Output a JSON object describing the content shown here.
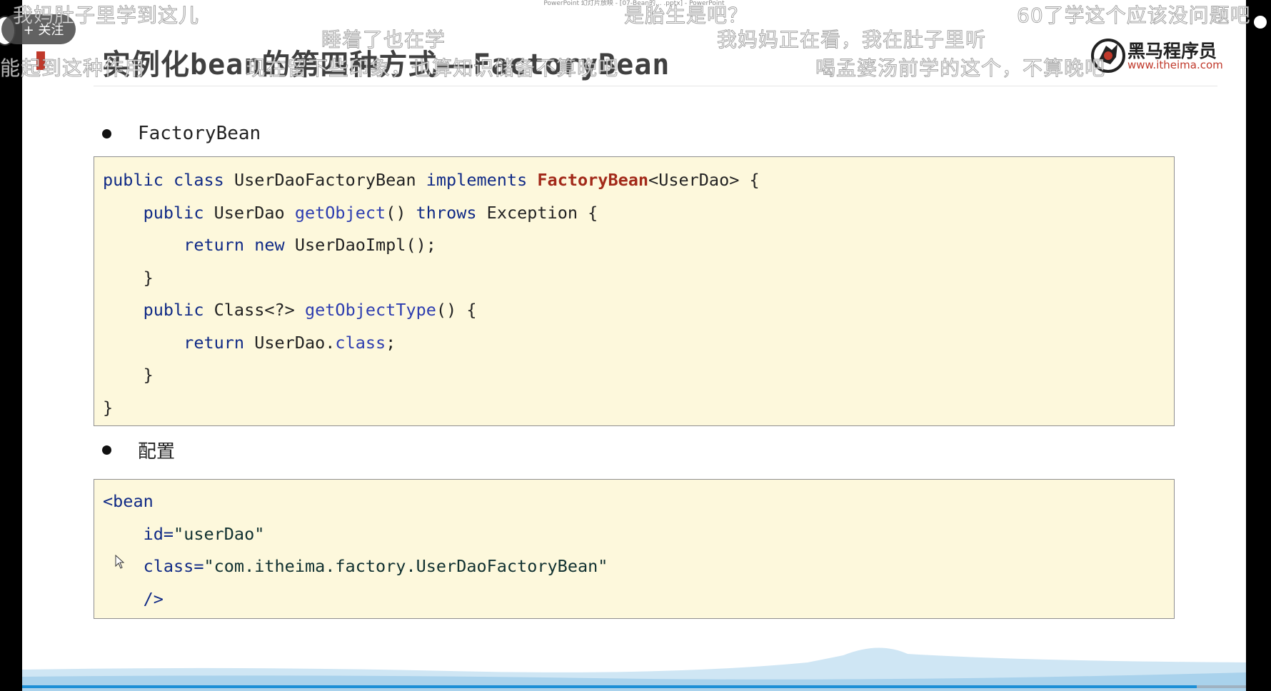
{
  "window": {
    "title": "PowerPoint 幻灯片放映 - [07-Bean的... .pptx] - PowerPoint"
  },
  "slide": {
    "title": "实例化bean的第四种方式——FactoryBean",
    "logo": {
      "name": "黑马程序员",
      "url": "www.itheima.com"
    },
    "bullets": [
      {
        "text": "FactoryBean"
      },
      {
        "text": "配置"
      }
    ],
    "code_java": [
      {
        "segments": [
          {
            "t": "public class ",
            "c": "kw"
          },
          {
            "t": "UserDaoFactoryBean ",
            "c": ""
          },
          {
            "t": "implements ",
            "c": "kw"
          },
          {
            "t": "FactoryBean",
            "c": "type-red"
          },
          {
            "t": "<UserDao> {",
            "c": ""
          }
        ]
      },
      {
        "segments": [
          {
            "t": "    public ",
            "c": "kw"
          },
          {
            "t": "UserDao ",
            "c": ""
          },
          {
            "t": "getObject",
            "c": "fn"
          },
          {
            "t": "() ",
            "c": ""
          },
          {
            "t": "throws ",
            "c": "kw"
          },
          {
            "t": "Exception {",
            "c": ""
          }
        ]
      },
      {
        "segments": [
          {
            "t": "        return new ",
            "c": "kw"
          },
          {
            "t": "UserDaoImpl();",
            "c": ""
          }
        ]
      },
      {
        "segments": [
          {
            "t": "    }",
            "c": ""
          }
        ]
      },
      {
        "segments": [
          {
            "t": "    public ",
            "c": "kw"
          },
          {
            "t": "Class<?> ",
            "c": ""
          },
          {
            "t": "getObjectType",
            "c": "fn"
          },
          {
            "t": "() {",
            "c": ""
          }
        ]
      },
      {
        "segments": [
          {
            "t": "        return ",
            "c": "kw"
          },
          {
            "t": "UserDao.",
            "c": ""
          },
          {
            "t": "class",
            "c": "fn"
          },
          {
            "t": ";",
            "c": ""
          }
        ]
      },
      {
        "segments": [
          {
            "t": "    }",
            "c": ""
          }
        ]
      },
      {
        "segments": [
          {
            "t": "}",
            "c": ""
          }
        ]
      }
    ],
    "code_xml": [
      {
        "segments": [
          {
            "t": "<bean",
            "c": "kw"
          }
        ]
      },
      {
        "segments": [
          {
            "t": "    id=",
            "c": "kw"
          },
          {
            "t": "\"userDao\"",
            "c": "str"
          }
        ]
      },
      {
        "segments": [
          {
            "t": "    class=",
            "c": "kw"
          },
          {
            "t": "\"com.itheima.factory.UserDaoFactoryBean\"",
            "c": "str"
          }
        ]
      },
      {
        "segments": [
          {
            "t": "    />",
            "c": "kw"
          }
        ]
      }
    ]
  },
  "player": {
    "follow_label": "+ 关注",
    "danmaku": [
      {
        "text": "我妈肚子里学到这儿"
      },
      {
        "text": "能起到这种作用"
      },
      {
        "text": "睡着了也在学"
      },
      {
        "text": "现在留下些印象，也算知识储备不算晚吧"
      },
      {
        "text": "是胎生是吧？"
      },
      {
        "text": "我妈妈正在看，我在肚子里听"
      },
      {
        "text": "60了学这个应该没问题吧"
      },
      {
        "text": "喝孟婆汤前学的这个，不算晚吧"
      }
    ]
  }
}
